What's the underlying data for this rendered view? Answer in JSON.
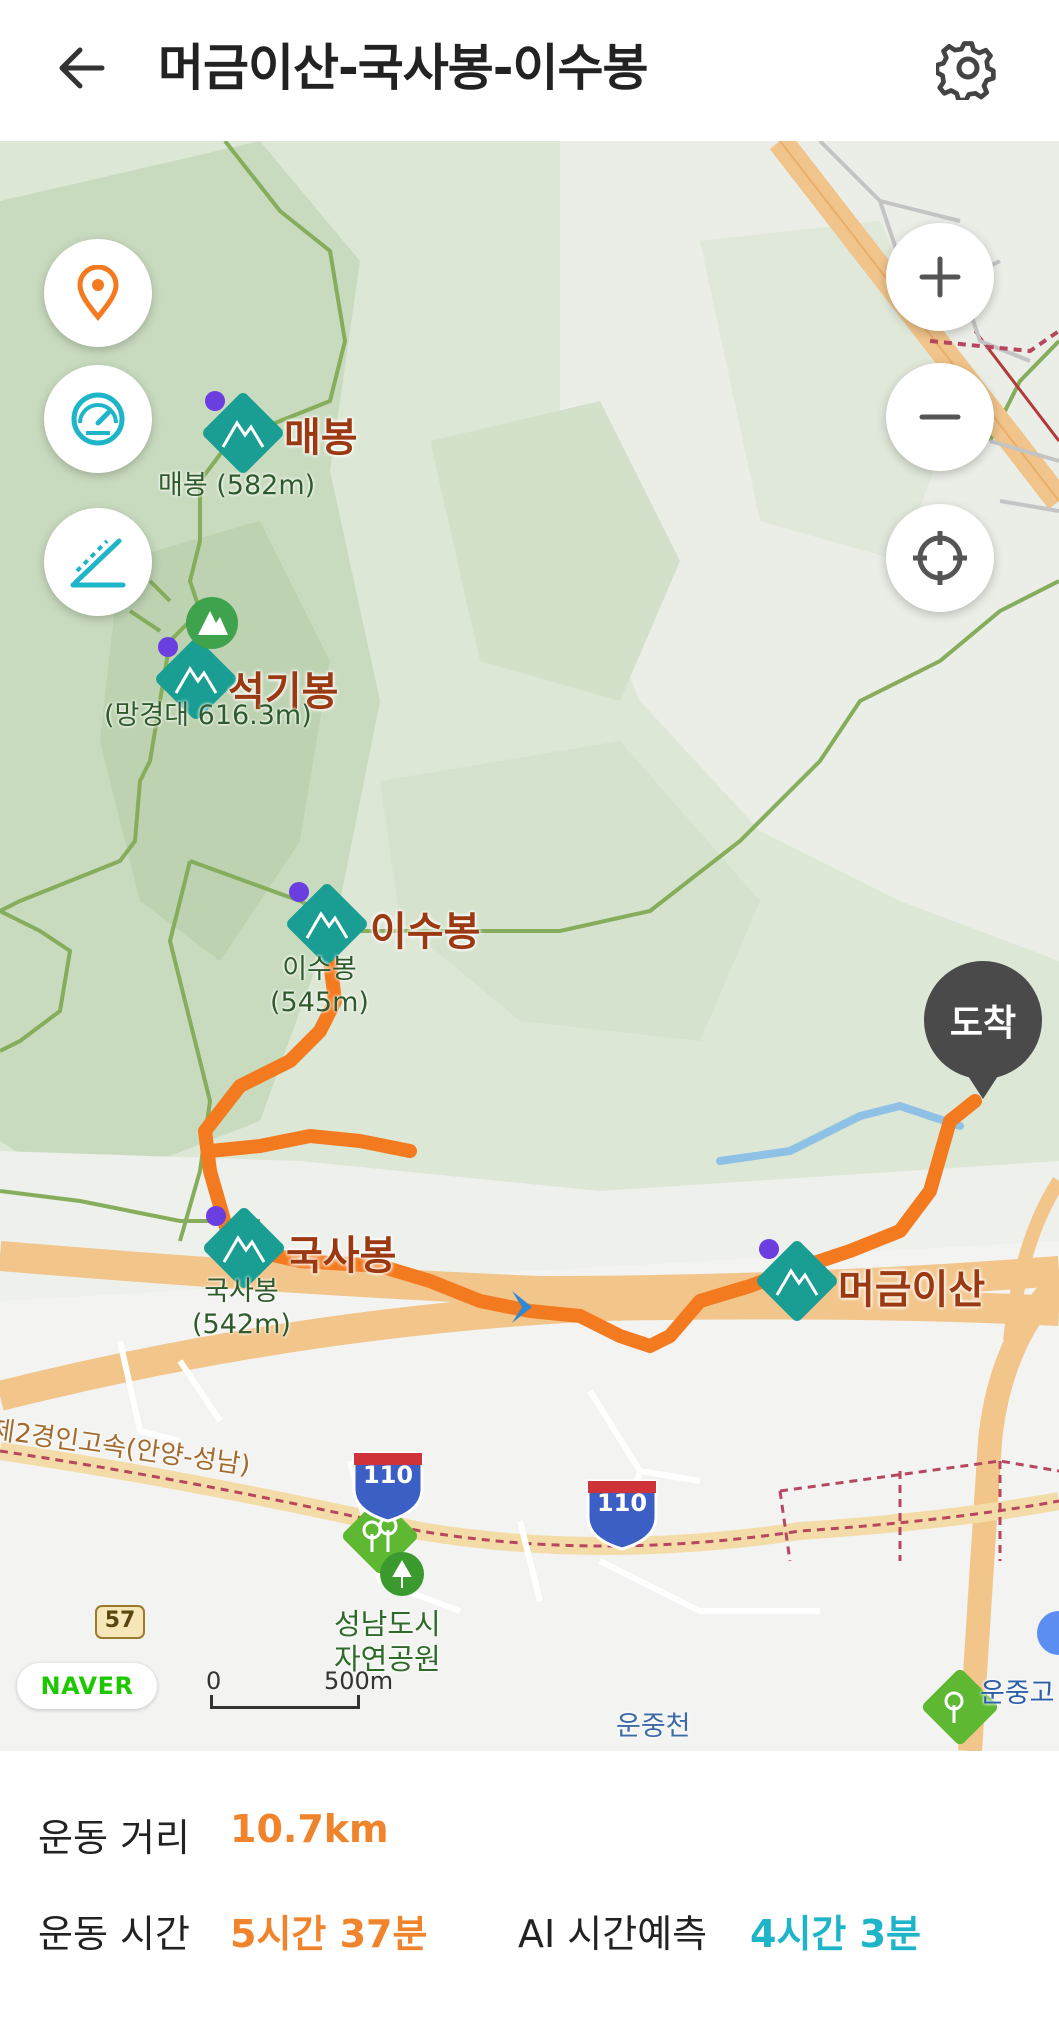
{
  "header": {
    "title": "머금이산-국사봉-이수봉",
    "back_icon": "arrow-left-icon",
    "settings_icon": "gear-icon"
  },
  "map": {
    "controls": {
      "left": [
        "location-pin-icon",
        "speedometer-icon",
        "elevation-icon"
      ],
      "right": [
        "zoom-in-icon",
        "zoom-out-icon",
        "crosshair-icon"
      ]
    },
    "peaks": [
      {
        "name": "매봉",
        "sub": "매봉 (582m)"
      },
      {
        "name": "석기봉",
        "sub": "(망경대 616.3m)"
      },
      {
        "name": "이수봉",
        "sub": "이수봉\n(545m)"
      },
      {
        "name": "국사봉",
        "sub": "국사봉\n(542m)"
      },
      {
        "name": "머금이산",
        "sub": ""
      }
    ],
    "arrive_label": "도착",
    "road_label": "제2경인고속(안양-성남)",
    "highway_shield": "110",
    "route_shield": "57",
    "park_label": "성남도시\n자연공원",
    "stream_label": "운중천",
    "school_label": "운중고",
    "naver_logo": "NAVER",
    "scale": {
      "zero": "0",
      "length": "500m"
    },
    "colors": {
      "route": "#f47a1f",
      "peak_icon": "#1a9e93"
    }
  },
  "stats": {
    "distance_label": "운동 거리",
    "distance_value": "10.7km",
    "time_label": "운동 시간",
    "time_value": "5시간 37분",
    "ai_label": "AI 시간예측",
    "ai_value": "4시간 3분"
  }
}
